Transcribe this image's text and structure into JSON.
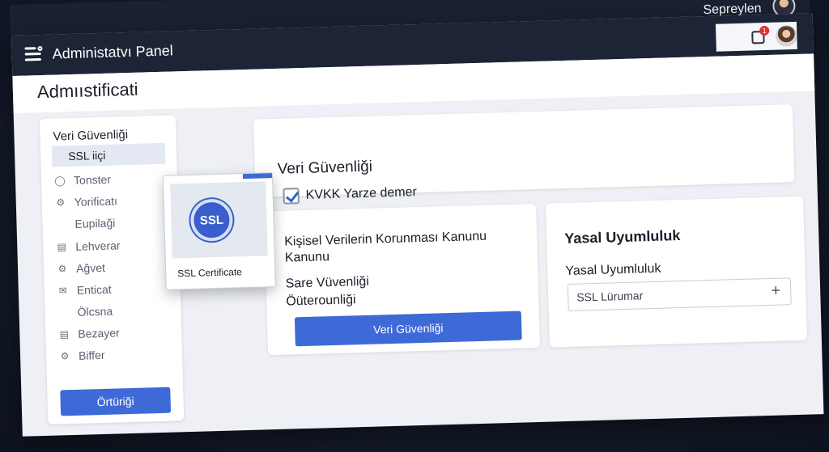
{
  "header": {
    "app_title": "Administatvı Panel",
    "user_name": "Sepreylen",
    "notification_count": "1"
  },
  "page_title": "Admııstificati",
  "sidebar": {
    "title": "Veri Güvenliği",
    "items": [
      {
        "label": "SSL iiçi",
        "icon": "none",
        "active": true
      },
      {
        "label": "Tonster",
        "icon": "lock-icon"
      },
      {
        "label": "Yorificatı",
        "icon": "gear-icon"
      },
      {
        "label": "Eupilaği",
        "icon": "none"
      },
      {
        "label": "Lehverar",
        "icon": "chart-icon"
      },
      {
        "label": "Ağvet",
        "icon": "cog-icon"
      },
      {
        "label": "Enticat",
        "icon": "mail-icon"
      },
      {
        "label": "Ölcsna",
        "icon": "none"
      },
      {
        "label": "Bezayer",
        "icon": "printer-icon"
      },
      {
        "label": "Biffer",
        "icon": "settings-icon"
      }
    ],
    "button_label": "Örtüriği"
  },
  "ssl_card": {
    "seal_text": "SSL",
    "label": "SSL Certificate"
  },
  "top_panel": {
    "heading": "Veri Güvenliği",
    "checkbox_label": "KVKK Yarze demer",
    "checked": true
  },
  "left_panel": {
    "line1": "Kişisel Verilerin Korunması Kanunu",
    "line2": "Kanunu",
    "line3": "Sare Vüvenliği",
    "line4": "Öüterounliği",
    "button_label": "Veri Güvenliği"
  },
  "right_panel": {
    "title": "Yasal Uyumluluk",
    "subtitle": "Yasal Uyumluluk",
    "input_value": "SSL Lürumar"
  },
  "colors": {
    "accent": "#3e6ad8",
    "header_bg": "#1c2435",
    "badge": "#e03131"
  }
}
